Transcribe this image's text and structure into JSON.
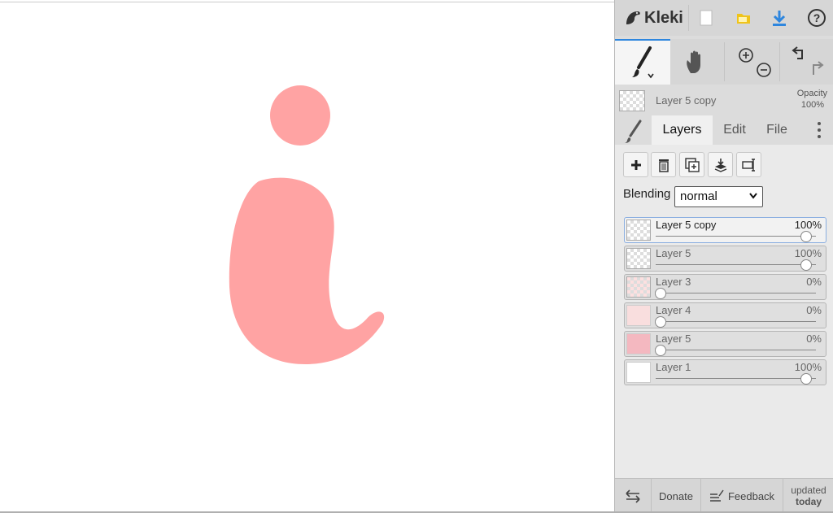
{
  "app": {
    "name": "Kleki",
    "brand_color": "#333333",
    "accent_color": "#2e86de"
  },
  "topbar": {
    "buttons": [
      {
        "icon": "new-document-icon"
      },
      {
        "icon": "open-folder-icon",
        "color": "#f0c419"
      },
      {
        "icon": "download-icon",
        "color": "#2e86de"
      },
      {
        "icon": "help-icon"
      }
    ]
  },
  "tools": {
    "items": [
      {
        "icon": "brush-icon",
        "active": true
      },
      {
        "icon": "hand-icon"
      },
      {
        "icon": "zoom-in-icon"
      },
      {
        "icon": "zoom-out-icon"
      },
      {
        "icon": "undo-icon"
      },
      {
        "icon": "redo-icon"
      }
    ]
  },
  "current_layer": {
    "name": "Layer 5 copy",
    "opacity_label": "Opacity",
    "opacity_value": "100%"
  },
  "tabs": {
    "items": [
      {
        "label": "Layers",
        "active": true
      },
      {
        "label": "Edit"
      },
      {
        "label": "File"
      }
    ]
  },
  "layer_actions": [
    {
      "icon": "add-layer-icon"
    },
    {
      "icon": "delete-layer-icon"
    },
    {
      "icon": "duplicate-layer-icon"
    },
    {
      "icon": "merge-down-icon"
    },
    {
      "icon": "rename-layer-icon"
    }
  ],
  "blending": {
    "label": "Blending",
    "value": "normal"
  },
  "layers": [
    {
      "name": "Layer 5 copy",
      "opacity": "100%",
      "opacity_fraction": 1.0,
      "active": true
    },
    {
      "name": "Layer 5",
      "opacity": "100%",
      "opacity_fraction": 1.0
    },
    {
      "name": "Layer 3",
      "opacity": "0%",
      "opacity_fraction": 0.0
    },
    {
      "name": "Layer 4",
      "opacity": "0%",
      "opacity_fraction": 0.0
    },
    {
      "name": "Layer 5",
      "opacity": "0%",
      "opacity_fraction": 0.0
    },
    {
      "name": "Layer 1",
      "opacity": "100%",
      "opacity_fraction": 1.0
    }
  ],
  "canvas": {
    "paint_color": "#ffa3a3",
    "background": "#ffffff"
  },
  "bottombar": {
    "donate": "Donate",
    "feedback": "Feedback",
    "updated_line1": "updated",
    "updated_line2": "today"
  }
}
